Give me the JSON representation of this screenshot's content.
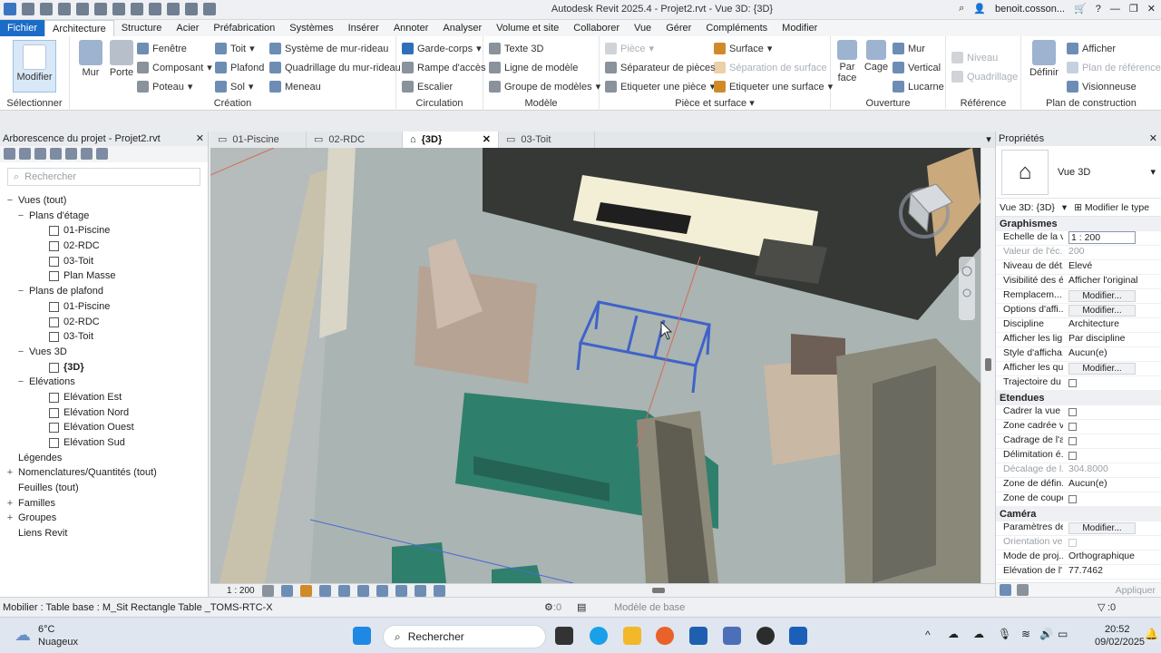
{
  "window": {
    "title": "Autodesk Revit 2025.4 - Projet2.rvt - Vue 3D: {3D}",
    "user": "benoit.cosson...",
    "help": "?"
  },
  "menu": {
    "items": [
      "Fichier",
      "Architecture",
      "Structure",
      "Acier",
      "Préfabrication",
      "Systèmes",
      "Insérer",
      "Annoter",
      "Analyser",
      "Volume et site",
      "Collaborer",
      "Vue",
      "Gérer",
      "Compléments",
      "Modifier"
    ],
    "active_index": 1
  },
  "ribbon": {
    "select": {
      "button": "Modifier",
      "label": "Sélectionner"
    },
    "creation": {
      "mur": "Mur",
      "porte": "Porte",
      "fenetre": "Fenêtre",
      "composant": "Composant",
      "poteau": "Poteau",
      "toit": "Toit",
      "plafond": "Plafond",
      "sol": "Sol",
      "systeme_mur_rideau": "Système de mur-rideau",
      "quadrillage_mur_rideau": "Quadrillage du mur-rideau",
      "meneau": "Meneau",
      "label": "Création"
    },
    "circulation": {
      "garde_corps": "Garde-corps",
      "rampe": "Rampe d'accès",
      "escalier": "Escalier",
      "label": "Circulation"
    },
    "modele": {
      "texte3d": "Texte 3D",
      "ligne": "Ligne de modèle",
      "groupe": "Groupe de modèles",
      "label": "Modèle"
    },
    "piece": {
      "piece": "Pièce",
      "separateur": "Séparateur de pièces",
      "etiqueter_piece": "Etiqueter une pièce",
      "surface": "Surface",
      "separation": "Séparation de surface",
      "etiqueter_surface": "Etiqueter une surface",
      "label": "Pièce et surface"
    },
    "ouverture": {
      "par_face": "Par face",
      "cage": "Cage",
      "mur": "Mur",
      "vertical": "Vertical",
      "lucarne": "Lucarne",
      "label": "Ouverture"
    },
    "reference": {
      "niveau": "Niveau",
      "quadrillage": "Quadrillage",
      "label": "Référence"
    },
    "plan": {
      "definir": "Définir",
      "afficher": "Afficher",
      "plan_ref": "Plan de référence",
      "visionneuse": "Visionneuse",
      "label": "Plan de construction"
    }
  },
  "project_browser": {
    "title": "Arborescence du projet - Projet2.rvt",
    "search_placeholder": "Rechercher",
    "nodes": [
      {
        "label": "Vues (tout)",
        "level": 0,
        "exp": "−"
      },
      {
        "label": "Plans d'étage",
        "level": 1,
        "exp": "−"
      },
      {
        "label": "01-Piscine",
        "level": 2,
        "view": true
      },
      {
        "label": "02-RDC",
        "level": 2,
        "view": true
      },
      {
        "label": "03-Toit",
        "level": 2,
        "view": true
      },
      {
        "label": "Plan Masse",
        "level": 2,
        "view": true
      },
      {
        "label": "Plans de plafond",
        "level": 1,
        "exp": "−"
      },
      {
        "label": "01-Piscine",
        "level": 2,
        "view": true
      },
      {
        "label": "02-RDC",
        "level": 2,
        "view": true
      },
      {
        "label": "03-Toit",
        "level": 2,
        "view": true
      },
      {
        "label": "Vues 3D",
        "level": 1,
        "exp": "−"
      },
      {
        "label": "{3D}",
        "level": 2,
        "view": true,
        "bold": true
      },
      {
        "label": "Elévations",
        "level": 1,
        "exp": "−"
      },
      {
        "label": "Elévation Est",
        "level": 2,
        "view": true
      },
      {
        "label": "Elévation Nord",
        "level": 2,
        "view": true
      },
      {
        "label": "Elévation Ouest",
        "level": 2,
        "view": true
      },
      {
        "label": "Elévation Sud",
        "level": 2,
        "view": true
      },
      {
        "label": "Légendes",
        "level": 0,
        "exp": ""
      },
      {
        "label": "Nomenclatures/Quantités (tout)",
        "level": 0,
        "exp": "+"
      },
      {
        "label": "Feuilles (tout)",
        "level": 0,
        "exp": ""
      },
      {
        "label": "Familles",
        "level": 0,
        "exp": "+"
      },
      {
        "label": "Groupes",
        "level": 0,
        "exp": "+"
      },
      {
        "label": "Liens Revit",
        "level": 0,
        "exp": ""
      }
    ]
  },
  "view_tabs": [
    {
      "label": "01-Piscine",
      "active": false
    },
    {
      "label": "02-RDC",
      "active": false
    },
    {
      "label": "{3D}",
      "active": true
    },
    {
      "label": "03-Toit",
      "active": false
    }
  ],
  "view_status": {
    "scale": "1 : 200"
  },
  "properties": {
    "title": "Propriétés",
    "type_name": "Vue 3D",
    "selector": "Vue 3D: {3D}",
    "edit_type": "Modifier le type",
    "sections": [
      {
        "name": "Graphismes",
        "rows": [
          {
            "k": "Echelle de la v...",
            "v": "1 : 200",
            "kind": "input"
          },
          {
            "k": "Valeur de l'éc...",
            "v": "200",
            "kind": "dis"
          },
          {
            "k": "Niveau de dét...",
            "v": "Elevé"
          },
          {
            "k": "Visibilité des é...",
            "v": "Afficher l'original"
          },
          {
            "k": "Remplacem...",
            "v": "Modifier...",
            "kind": "btn"
          },
          {
            "k": "Options d'affi...",
            "v": "Modifier...",
            "kind": "btn"
          },
          {
            "k": "Discipline",
            "v": "Architecture"
          },
          {
            "k": "Afficher les lig...",
            "v": "Par discipline"
          },
          {
            "k": "Style d'afficha...",
            "v": "Aucun(e)"
          },
          {
            "k": "Afficher les qu...",
            "v": "Modifier...",
            "kind": "btn"
          },
          {
            "k": "Trajectoire du ...",
            "v": "",
            "kind": "chk"
          }
        ]
      },
      {
        "name": "Etendues",
        "rows": [
          {
            "k": "Cadrer la vue",
            "v": "",
            "kind": "chk"
          },
          {
            "k": "Zone cadrée v...",
            "v": "",
            "kind": "chk"
          },
          {
            "k": "Cadrage de l'a...",
            "v": "",
            "kind": "chk"
          },
          {
            "k": "Délimitation é...",
            "v": "",
            "kind": "chk"
          },
          {
            "k": "Décalage de l...",
            "v": "304.8000",
            "kind": "dis"
          },
          {
            "k": "Zone de défin...",
            "v": "Aucun(e)"
          },
          {
            "k": "Zone de coupe",
            "v": "",
            "kind": "chk"
          }
        ]
      },
      {
        "name": "Caméra",
        "rows": [
          {
            "k": "Paramètres de...",
            "v": "Modifier...",
            "kind": "btn"
          },
          {
            "k": "Orientation ve...",
            "v": "",
            "kind": "dischk"
          },
          {
            "k": "Mode de proj...",
            "v": "Orthographique"
          },
          {
            "k": "Elévation de l'...",
            "v": "77.7462"
          }
        ]
      }
    ],
    "apply": "Appliquer"
  },
  "statusbar": {
    "selection": "Mobilier : Table base : M_Sit Rectangle Table _TOMS-RTC-X",
    "model": "Modèle de base",
    "count_left": ":0",
    "count_right": ":0"
  },
  "taskbar": {
    "weather_temp": "6°C",
    "weather_desc": "Nuageux",
    "search": "Rechercher",
    "time": "20:52",
    "date": "09/02/2025"
  }
}
